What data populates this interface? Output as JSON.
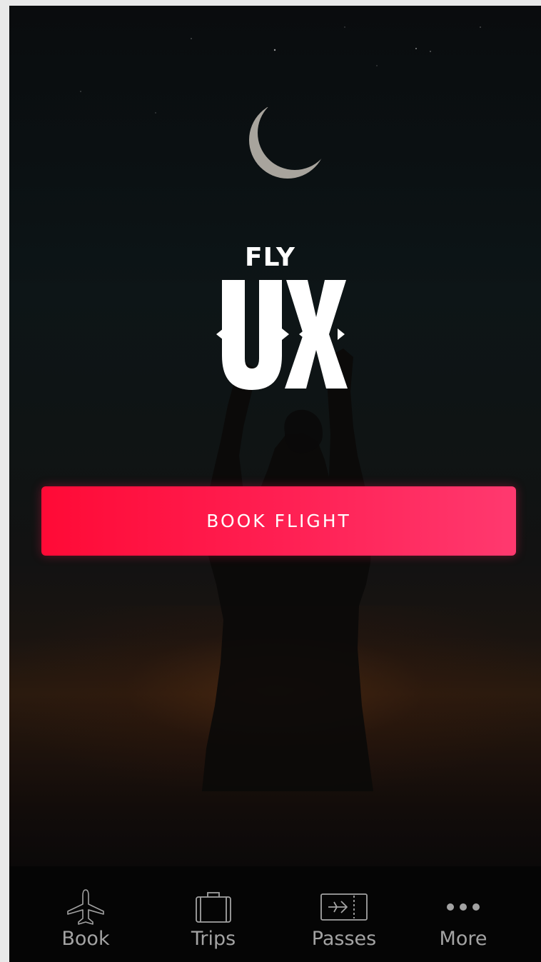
{
  "app": {
    "logo_top": "FLY",
    "logo_main": "UX"
  },
  "main": {
    "cta_label": "BOOK FLIGHT"
  },
  "tabbar": {
    "items": [
      {
        "label": "Book",
        "icon": "airplane-icon"
      },
      {
        "label": "Trips",
        "icon": "suitcase-icon"
      },
      {
        "label": "Passes",
        "icon": "boarding-pass-icon"
      },
      {
        "label": "More",
        "icon": "more-dots-icon"
      }
    ]
  },
  "colors": {
    "accent_start": "#ff0a36",
    "accent_end": "#ff396f",
    "tab_label": "#a3a3a3",
    "tabbar_bg": "#050505"
  }
}
